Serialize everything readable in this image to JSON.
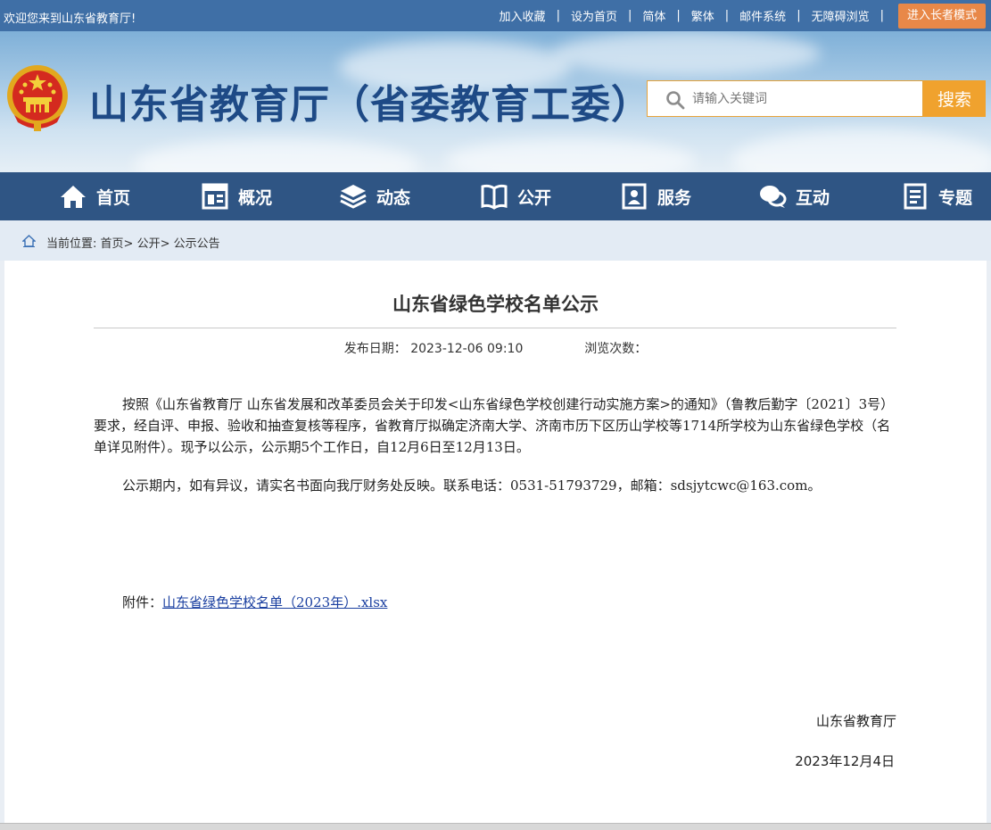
{
  "topbar": {
    "welcome": "欢迎您来到山东省教育厅!",
    "links": [
      "加入收藏",
      "设为首页",
      "简体",
      "繁体",
      "邮件系统",
      "无障碍浏览"
    ],
    "elder_mode": "进入长者模式"
  },
  "header": {
    "site_title": "山东省教育厅（省委教育工委）",
    "search_placeholder": "请输入关键词",
    "search_button": "搜索"
  },
  "nav": {
    "items": [
      {
        "label": "首页",
        "icon": "home-icon"
      },
      {
        "label": "概况",
        "icon": "overview-icon"
      },
      {
        "label": "动态",
        "icon": "layers-icon"
      },
      {
        "label": "公开",
        "icon": "book-icon"
      },
      {
        "label": "服务",
        "icon": "service-icon"
      },
      {
        "label": "互动",
        "icon": "chat-icon"
      },
      {
        "label": "专题",
        "icon": "topic-icon"
      }
    ]
  },
  "breadcrumb": {
    "prefix": "当前位置:",
    "items": [
      "首页",
      "公开",
      "公示公告"
    ],
    "separator": ">"
  },
  "article": {
    "title": "山东省绿色学校名单公示",
    "publish_label": "发布日期：",
    "publish_date": "2023-12-06 09:10",
    "views_label": "浏览次数：",
    "paragraph1": "按照《山东省教育厅 山东省发展和改革委员会关于印发<山东省绿色学校创建行动实施方案>的通知》（鲁教后勤字〔2021〕3号）要求，经自评、申报、验收和抽查复核等程序，省教育厅拟确定济南大学、济南市历下区历山学校等1714所学校为山东省绿色学校（名单详见附件）。现予以公示，公示期5个工作日，自12月6日至12月13日。",
    "paragraph2": "公示期内，如有异议，请实名书面向我厅财务处反映。联系电话：0531-51793729，邮箱：sdsjytcwc@163.com。",
    "attachment_label": "附件：",
    "attachment_link": "山东省绿色学校名单（2023年）.xlsx",
    "signature": "山东省教育厅",
    "sign_date": "2023年12月4日"
  }
}
